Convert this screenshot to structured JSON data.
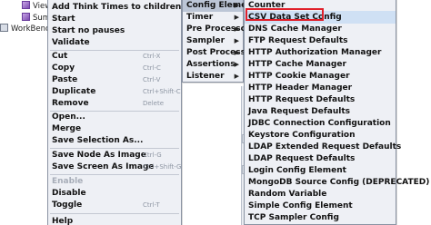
{
  "tree": {
    "items": [
      {
        "label": "View",
        "icon": "view-results-icon"
      },
      {
        "label": "Sum",
        "icon": "summary-report-icon"
      },
      {
        "label": "WorkBench",
        "icon": "workbench-icon"
      }
    ]
  },
  "context_menu": {
    "items": [
      {
        "label": "Add Think Times to children"
      },
      {
        "label": "Start"
      },
      {
        "label": "Start no pauses"
      },
      {
        "label": "Validate"
      },
      {
        "label": "Cut",
        "shortcut": "Ctrl-X"
      },
      {
        "label": "Copy",
        "shortcut": "Ctrl-C"
      },
      {
        "label": "Paste",
        "shortcut": "Ctrl-V"
      },
      {
        "label": "Duplicate",
        "shortcut": "Ctrl+Shift-C"
      },
      {
        "label": "Remove",
        "shortcut": "Delete"
      },
      {
        "label": "Open..."
      },
      {
        "label": "Merge"
      },
      {
        "label": "Save Selection As..."
      },
      {
        "label": "Save Node As Image",
        "shortcut": "Ctrl-G"
      },
      {
        "label": "Save Screen As Image",
        "shortcut": "Ctrl+Shift-G"
      },
      {
        "label": "Enable",
        "disabled": true
      },
      {
        "label": "Disable"
      },
      {
        "label": "Toggle",
        "shortcut": "Ctrl-T"
      },
      {
        "label": "Help"
      }
    ]
  },
  "add_submenu": {
    "items": [
      {
        "label": "Config Element"
      },
      {
        "label": "Timer"
      },
      {
        "label": "Pre Processors"
      },
      {
        "label": "Sampler"
      },
      {
        "label": "Post Processors"
      },
      {
        "label": "Assertions"
      },
      {
        "label": "Listener"
      }
    ]
  },
  "config_submenu": {
    "items": [
      {
        "label": "Counter"
      },
      {
        "label": "CSV Data Set Config"
      },
      {
        "label": "DNS Cache Manager"
      },
      {
        "label": "FTP Request Defaults"
      },
      {
        "label": "HTTP Authorization Manager"
      },
      {
        "label": "HTTP Cache Manager"
      },
      {
        "label": "HTTP Cookie Manager"
      },
      {
        "label": "HTTP Header Manager"
      },
      {
        "label": "HTTP Request Defaults"
      },
      {
        "label": "Java Request Defaults"
      },
      {
        "label": "JDBC Connection Configuration"
      },
      {
        "label": "Keystore Configuration"
      },
      {
        "label": "LDAP Extended Request Defaults"
      },
      {
        "label": "LDAP Request Defaults"
      },
      {
        "label": "Login Config Element"
      },
      {
        "label": "MongoDB Source Config (DEPRECATED)"
      },
      {
        "label": "Random Variable"
      },
      {
        "label": "Simple Config Element"
      },
      {
        "label": "TCP Sampler Config"
      }
    ]
  },
  "colors": {
    "menu_bg": "#eef0f5",
    "active_item": "#bcc6d6",
    "highlight_border": "#e0202a"
  }
}
